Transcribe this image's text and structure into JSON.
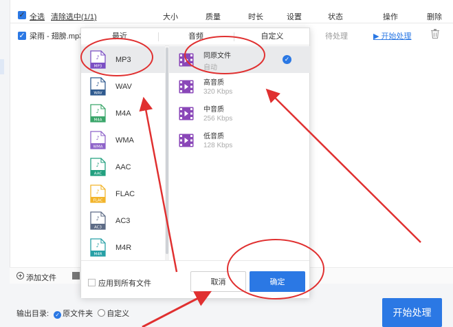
{
  "header": {
    "select_all": "全选",
    "clear_selected": "清除选中(1/1)",
    "col_size": "大小",
    "col_quality": "质量",
    "col_duration": "时长",
    "col_settings": "设置",
    "col_status": "状态",
    "col_action": "操作",
    "col_delete": "删除"
  },
  "file_row": {
    "name": "梁雨 - 翅膀.mp3",
    "status": "待处理",
    "action": "▶ 开始处理"
  },
  "popup": {
    "tabs": [
      "最近",
      "音频",
      "自定义"
    ],
    "formats": [
      {
        "label": "MP3",
        "icon_text": "MP3",
        "color": "#7b4fc4",
        "selected": true
      },
      {
        "label": "WAV",
        "icon_text": "WAV",
        "color": "#2f5a8f"
      },
      {
        "label": "M4A",
        "icon_text": "M4A",
        "color": "#3aa66a"
      },
      {
        "label": "WMA",
        "icon_text": "WMA",
        "color": "#8e63c9"
      },
      {
        "label": "AAC",
        "icon_text": "AAC",
        "color": "#22a07f"
      },
      {
        "label": "FLAC",
        "icon_text": "FLAC",
        "color": "#f2b42a"
      },
      {
        "label": "AC3",
        "icon_text": "AC3",
        "color": "#5d6b86"
      },
      {
        "label": "M4R",
        "icon_text": "M4R",
        "color": "#27a0a6"
      }
    ],
    "qualities": [
      {
        "name": "同原文件",
        "sub": "自动",
        "selected": true
      },
      {
        "name": "高音质",
        "sub": "320 Kbps"
      },
      {
        "name": "中音质",
        "sub": "256 Kbps"
      },
      {
        "name": "低音质",
        "sub": "128 Kbps"
      }
    ],
    "apply_all": "应用到所有文件",
    "cancel": "取消",
    "ok": "确定"
  },
  "footer": {
    "add_file": "添加文件",
    "output_label": "输出目录:",
    "opt_source": "原文件夹",
    "opt_custom": "自定义",
    "start": "开始处理"
  },
  "colors": {
    "accent": "#2b78e4",
    "annotation": "#e03030"
  }
}
